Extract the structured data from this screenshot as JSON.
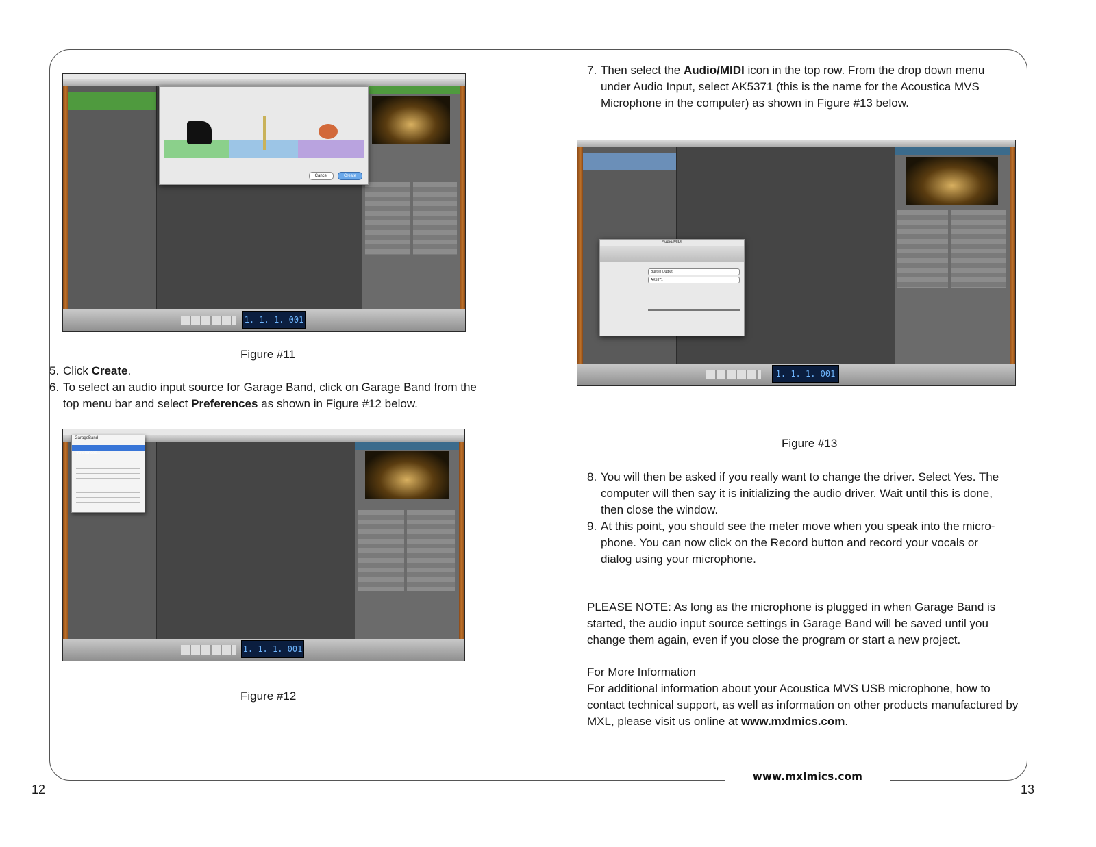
{
  "footer": {
    "url": "www.mxlmics.com"
  },
  "page_numbers": {
    "left": "12",
    "right": "13"
  },
  "figures": {
    "fig11": {
      "caption": "Figure #11",
      "lcd": "1. 1. 1. 001",
      "dialog_cancel": "Cancel",
      "dialog_create": "Create"
    },
    "fig12": {
      "caption": "Figure #12",
      "lcd": "1. 1. 1. 001",
      "menu_title": "GarageBand",
      "menu_item": "Preferences..."
    },
    "fig13": {
      "caption": "Figure #13",
      "lcd": "1. 1. 1. 001",
      "dialog_title": "Audio/MIDI",
      "audio_output": "Built-in Output",
      "audio_input": "AK5371"
    }
  },
  "left_steps": [
    {
      "num": "5.",
      "before": "Click ",
      "bold": "Create",
      "after": "."
    },
    {
      "num": "6.",
      "before": "To select an audio input source for Garage Band, click on Garage Band from the top menu bar and select ",
      "bold": "Preferences",
      "after": " as shown in Figure #12 below."
    }
  ],
  "right_steps": {
    "step7": {
      "num": "7.",
      "before": "Then select the ",
      "bold": "Audio/MIDI",
      "after": " icon in the top row. From the drop down menu under Audio Input, select AK5371 (this is the name for the Acoustica MVS Microphone in the computer) as shown in Figure #13 below."
    },
    "step8": {
      "num": "8.",
      "text": "You will then be asked if you really want to change the driver. Select Yes. The computer will then say it is initializing the audio driver. Wait until this is done, then close the window."
    },
    "step9": {
      "num": "9.",
      "text": "At this point, you should see the meter move when you speak into the micro-phone. You can now click on the Record button and record your vocals or dialog using your microphone."
    }
  },
  "note": "PLEASE NOTE: As long as the microphone is plugged in when Garage Band is started, the audio input source settings in Garage Band will be saved until you change them again, even if you close the program or start a new project.",
  "more_info": {
    "heading": "For More Information",
    "text_before": "For additional information about your Acoustica MVS USB microphone, how to contact technical support, as well as information on other products manufactured by MXL, please visit us online at ",
    "link": "www.mxlmics.com",
    "text_after": "."
  }
}
